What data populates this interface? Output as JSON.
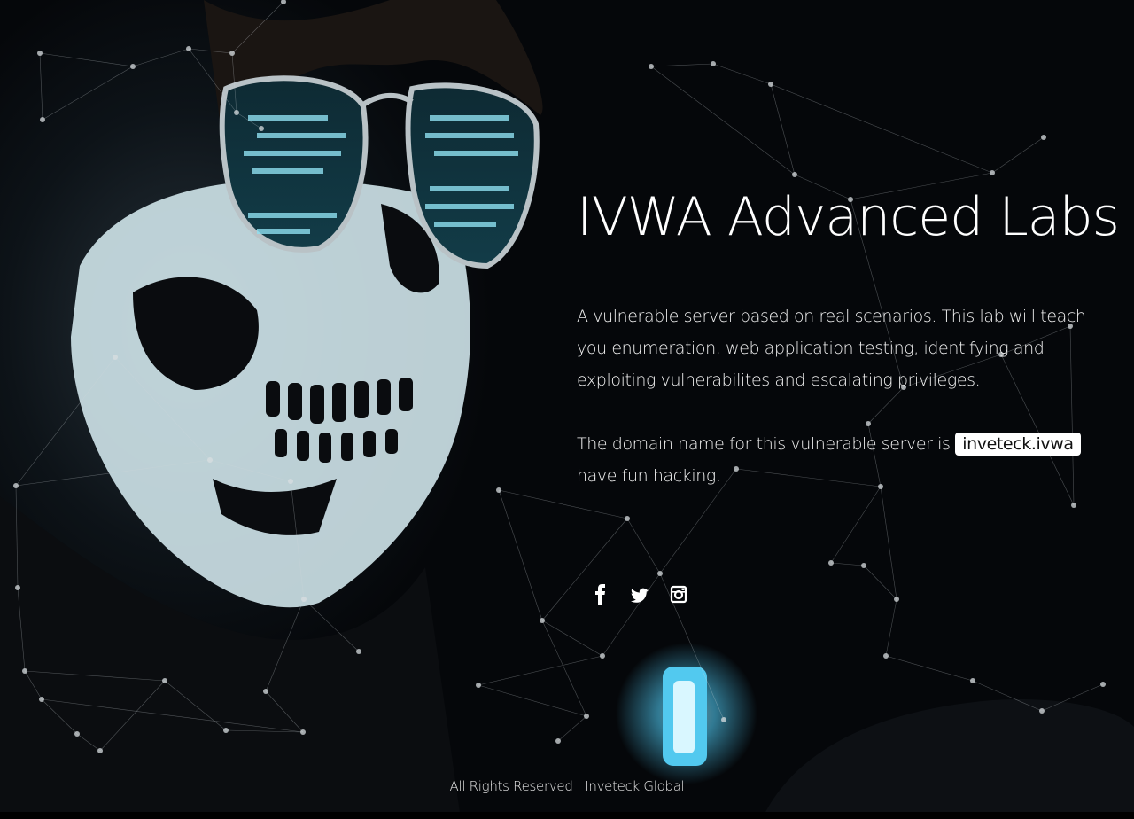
{
  "hero": {
    "title": "IVWA Advanced Labs",
    "description": "A vulnerable server based on real scenarios. This lab will teach you enumeration, web application testing, identifying and exploiting vulnerabilites and escalating privileges.",
    "domain_prefix": "The domain name for this vulnerable server is",
    "domain": "inveteck.ivwa",
    "domain_suffix": "have fun hacking."
  },
  "social": [
    {
      "icon": "facebook-icon"
    },
    {
      "icon": "twitter-icon"
    },
    {
      "icon": "instagram-icon"
    }
  ],
  "footer": {
    "text": "All Rights Reserved",
    "separator": "|",
    "link": "Inveteck Global"
  },
  "colors": {
    "background": "#05070a",
    "text": "#ffffff",
    "accent_glow": "#58c8f0",
    "badge_bg": "#ffffff"
  }
}
